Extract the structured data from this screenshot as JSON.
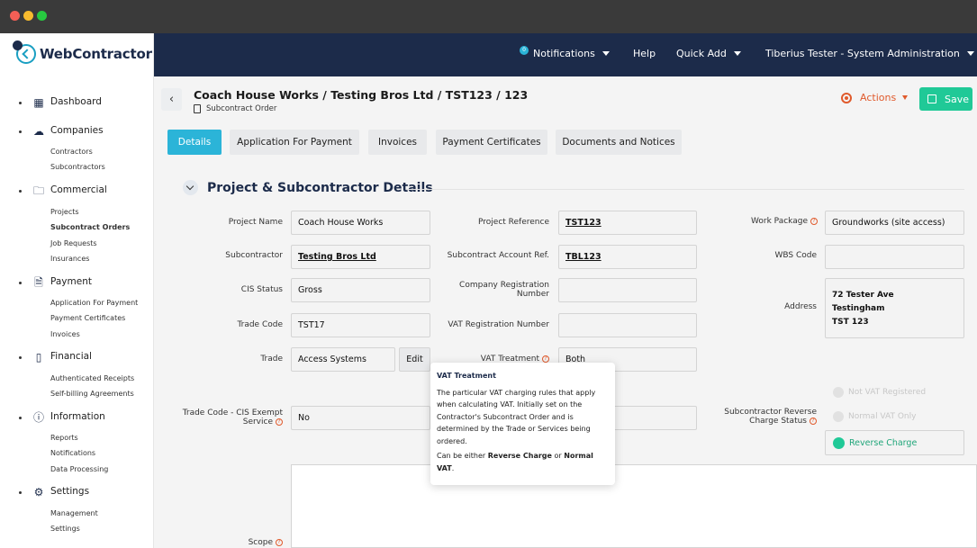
{
  "window": {
    "dots": [
      "#f35f56",
      "#f7bb2e",
      "#27c840"
    ]
  },
  "logo": {
    "text": "WebContractor"
  },
  "sidebar": {
    "sections": [
      {
        "icon": "dashboard-icon",
        "label": "Dashboard",
        "items": []
      },
      {
        "icon": "cloud-icon",
        "label": "Companies",
        "items": [
          "Contractors",
          "Subcontractors"
        ]
      },
      {
        "icon": "folder-icon",
        "label": "Commercial",
        "items": [
          "Projects",
          "Subcontract Orders",
          "Job Requests",
          "Insurances"
        ]
      },
      {
        "icon": "document-icon",
        "label": "Payment",
        "items": [
          "Application For Payment",
          "Payment Certificates",
          "Invoices"
        ]
      },
      {
        "icon": "book-icon",
        "label": "Financial",
        "items": [
          "Authenticated Receipts",
          "Self-billing Agreements"
        ]
      },
      {
        "icon": "info-icon",
        "label": "Information",
        "items": [
          "Reports",
          "Notifications",
          "Data Processing"
        ]
      },
      {
        "icon": "gear-icon",
        "label": "Settings",
        "items": [
          "Management",
          "Settings"
        ]
      }
    ],
    "active_item": "Subcontract Orders"
  },
  "topnav": {
    "notifications_badge": "0",
    "notifications": "Notifications",
    "help": "Help",
    "quick_add": "Quick Add",
    "user": "Tiberius Tester - System Administration"
  },
  "header": {
    "title": "Coach House Works / Testing Bros Ltd / TST123 / 123",
    "subtitle": "Subcontract Order",
    "actions": "Actions",
    "save": "Save"
  },
  "tabs": [
    "Details",
    "Application For Payment",
    "Invoices",
    "Payment Certificates",
    "Documents and Notices"
  ],
  "section": {
    "title": "Project & Subcontractor Details"
  },
  "fields": {
    "project_name": {
      "label": "Project Name",
      "value": "Coach House Works"
    },
    "subcontractor": {
      "label": "Subcontractor",
      "value": "Testing Bros Ltd"
    },
    "cis_status": {
      "label": "CIS Status",
      "value": "Gross"
    },
    "trade_code": {
      "label": "Trade Code",
      "value": "TST17"
    },
    "trade": {
      "label": "Trade",
      "value": "Access Systems",
      "edit": "Edit"
    },
    "cis_exempt": {
      "label_line1": "Trade Code - CIS Exempt",
      "label_line2": "Service",
      "value": "No"
    },
    "scope": {
      "label": "Scope"
    },
    "project_reference": {
      "label": "Project Reference",
      "value": "TST123"
    },
    "subcontract_account_ref": {
      "label": "Subcontract Account Ref.",
      "value": "TBL123"
    },
    "company_registration": {
      "label_line1": "Company Registration",
      "label_line2": "Number",
      "value": ""
    },
    "vat_registration": {
      "label": "VAT Registration Number",
      "value": ""
    },
    "vat_treatment": {
      "label": "VAT Treatment",
      "value": "Both"
    },
    "work_package": {
      "label": "Work Package",
      "value": "Groundworks (site access)"
    },
    "wbs_code": {
      "label": "WBS Code",
      "value": ""
    },
    "address": {
      "label": "Address",
      "line1": "72 Tester Ave",
      "line2": "Testingham",
      "line3": "TST 123"
    },
    "reverse_charge_status": {
      "label_line1": "Subcontractor Reverse",
      "label_line2": "Charge Status"
    }
  },
  "radio_options": {
    "not_vat": "Not VAT Registered",
    "normal_vat": "Normal VAT Only",
    "reverse": "Reverse Charge"
  },
  "tooltip": {
    "title": "VAT Treatment",
    "body": "The particular VAT charging rules that apply when calculating VAT. Initially set on the Contractor's Subcontract Order and is determined by the Trade or Services being ordered.",
    "line2_prefix": "Can be either ",
    "opt1": "Reverse Charge",
    "or": " or ",
    "opt2": "Normal VAT",
    "end": "."
  }
}
